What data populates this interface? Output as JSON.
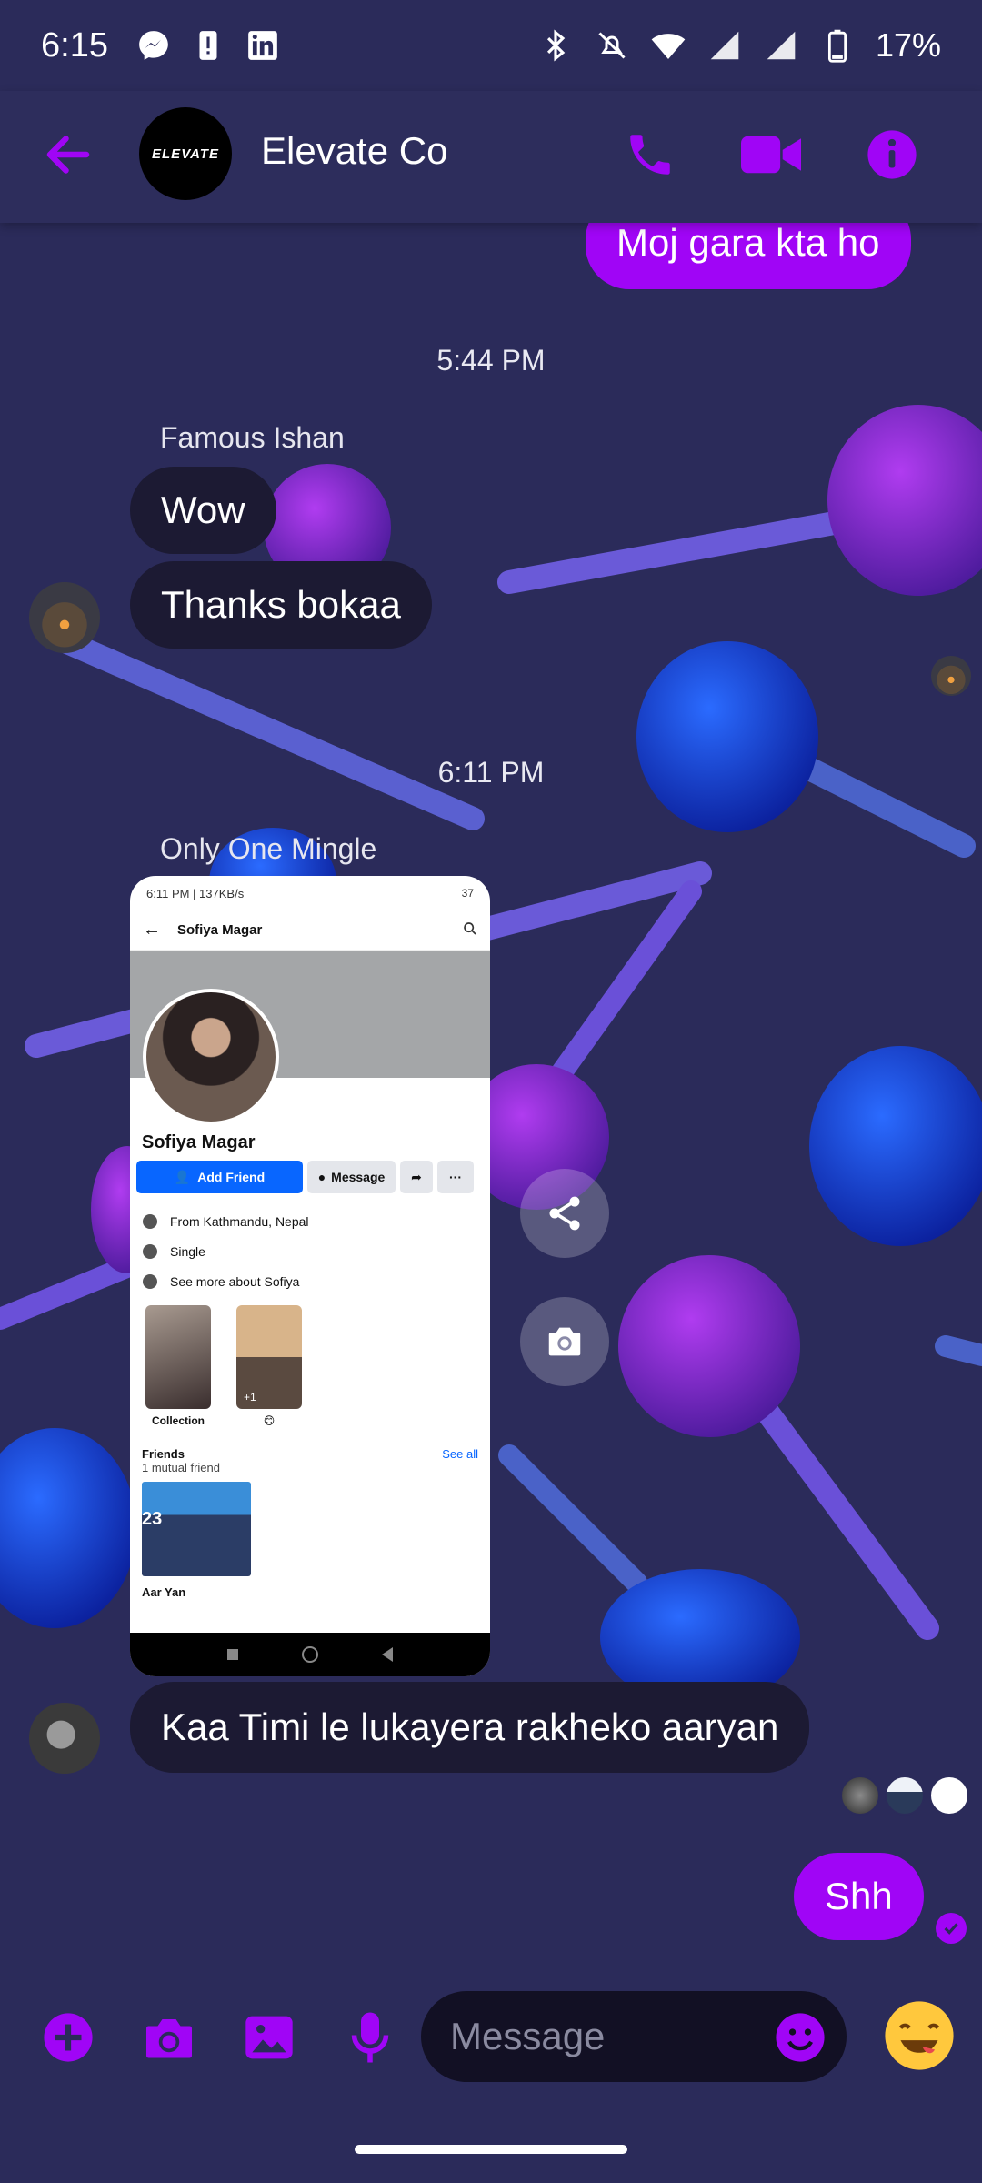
{
  "status_bar": {
    "time": "6:15",
    "battery": "17%",
    "left_icons": [
      "messenger-icon",
      "alert-icon",
      "linkedin-icon"
    ],
    "right_icons": [
      "bluetooth-icon",
      "dnd-icon",
      "wifi-icon",
      "signal-icon",
      "signal-icon",
      "battery-icon"
    ]
  },
  "header": {
    "title": "Elevate Co",
    "avatar_text": "ELEVATE",
    "accent": "#a005f6"
  },
  "messages": {
    "out_1": "Moj gara kta ho",
    "time_1": "5:44 PM",
    "sender_1": "Famous Ishan",
    "in_1": "Wow",
    "in_2": "Thanks bokaa",
    "time_2": "6:11 PM",
    "sender_2": "Only One Mingle",
    "in_3": "Kaa Timi le lukayera rakheko aaryan",
    "out_2": "Shh"
  },
  "shared_screenshot": {
    "status": "6:11 PM | 137KB/s",
    "battery": "37",
    "nav_title": "Sofiya Magar",
    "name": "Sofiya Magar",
    "add_friend": "Add Friend",
    "message": "Message",
    "more": "···",
    "info": [
      "From Kathmandu, Nepal",
      "Single",
      "See more about Sofiya"
    ],
    "tile_labels": [
      "Collection",
      "😊"
    ],
    "tile_overlay": "+1",
    "friends_label": "Friends",
    "see_all": "See all",
    "mutual": "1 mutual friend",
    "friend_name": "Aar Yan",
    "friend_pic_text": "23"
  },
  "composer": {
    "placeholder": "Message",
    "icons": [
      "plus-icon",
      "camera-icon",
      "image-icon",
      "mic-icon",
      "emoji-icon",
      "sticker-icon"
    ]
  },
  "colors": {
    "accent": "#a005f6",
    "background": "#2b2b5a",
    "bubble_in": "#1c1a33"
  }
}
